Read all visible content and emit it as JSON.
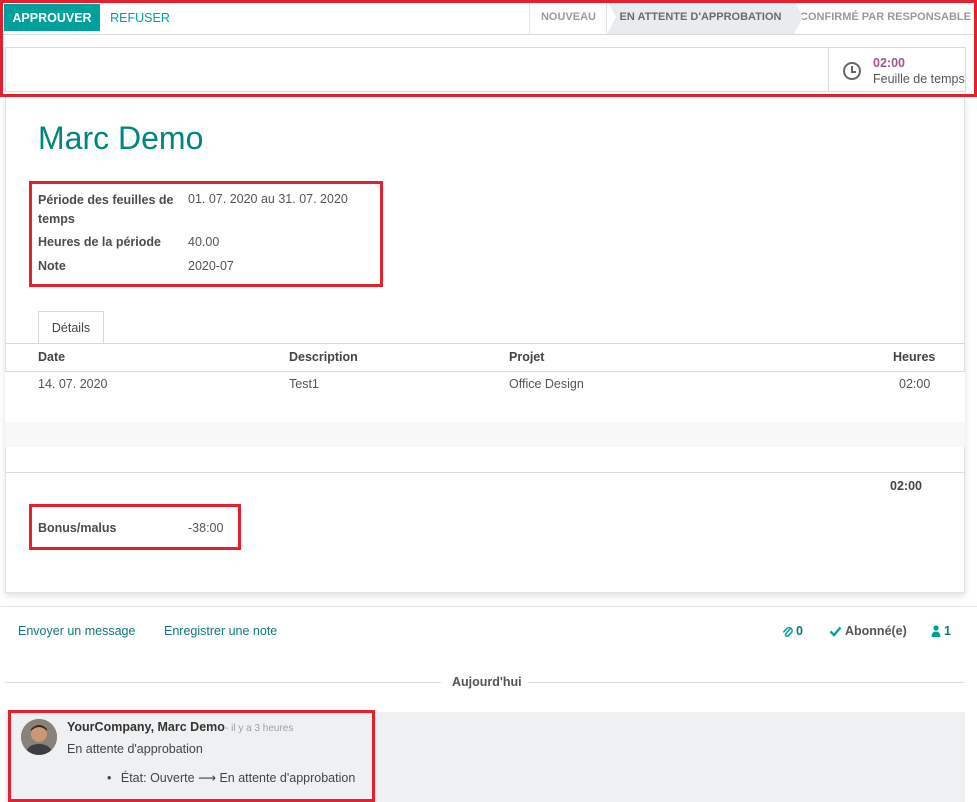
{
  "statusbar": {
    "approve_label": "APPROUVER",
    "refuse_label": "REFUSER",
    "stages": [
      "NOUVEAU",
      "EN ATTENTE D'APPROBATION",
      "CONFIRMÉ PAR RESPONSABLE"
    ],
    "active_stage": "EN ATTENTE D'APPROBATION"
  },
  "stat_button": {
    "icon": "clock-icon",
    "value": "02:00",
    "label": "Feuille de temps"
  },
  "record": {
    "name": "Marc Demo",
    "fields": [
      {
        "label": "Période des feuilles de temps",
        "value": "01. 07. 2020 au 31. 07. 2020"
      },
      {
        "label": "Heures de la période",
        "value": "40.00"
      },
      {
        "label": "Note",
        "value": "2020-07"
      }
    ],
    "bonus": {
      "label": "Bonus/malus",
      "value": "-38:00"
    }
  },
  "tab": {
    "label": "Détails"
  },
  "table": {
    "headers": [
      "Date",
      "Description",
      "Projet",
      "Heures"
    ],
    "rows": [
      [
        "14. 07. 2020",
        "Test1",
        "Office Design",
        "02:00"
      ]
    ],
    "total": "02:00"
  },
  "chatter": {
    "send_message": "Envoyer un message",
    "log_note": "Enregistrer une note",
    "attachments_count": "0",
    "follow_label": "Abonné(e)",
    "followers_count": "1",
    "day_label": "Aujourd'hui",
    "message": {
      "author": "YourCompany, Marc Demo",
      "ago": "- il y a 3 heures",
      "text": "En attente d'approbation",
      "change_field": "État:",
      "change_from": "Ouverte",
      "change_to": "En attente d'approbation"
    }
  },
  "colors": {
    "primary": "#00a09d",
    "title": "#00867f",
    "highlight": "#e5202e",
    "stat_value": "#9a5a8a"
  }
}
